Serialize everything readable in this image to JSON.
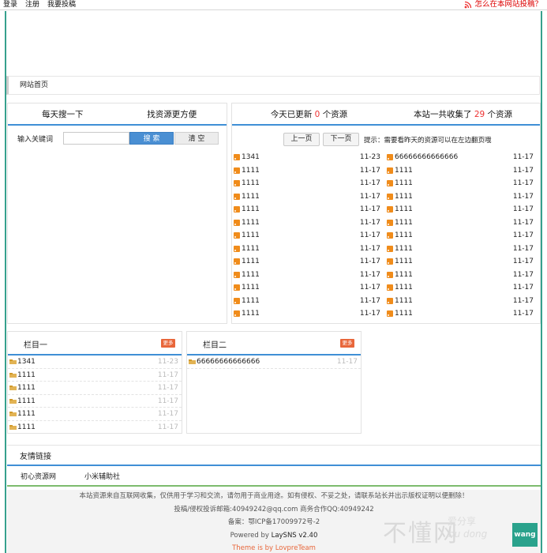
{
  "topbar": {
    "login": "登录",
    "register": "注册",
    "contribute": "我要投稿",
    "how_to_contribute": "怎么在本网站投稿？"
  },
  "nav": {
    "home": "网站首页"
  },
  "search": {
    "head_left": "每天搜一下",
    "head_right": "找资源更方便",
    "label": "输入关键词",
    "input_value": "",
    "search_btn": "搜 索",
    "clear_btn": "清 空"
  },
  "updates": {
    "today_prefix": "今天已更新",
    "today_count": "0",
    "today_suffix": "个资源",
    "total_prefix": "本站一共收集了",
    "total_count": "29",
    "total_suffix": "个资源",
    "prev": "上一页",
    "next": "下一页",
    "hint": "提示：需要看昨天的资源可以在左边翻页哦",
    "col1": [
      {
        "name": "1341",
        "date": "11-23"
      },
      {
        "name": "1111",
        "date": "11-17"
      },
      {
        "name": "1111",
        "date": "11-17"
      },
      {
        "name": "1111",
        "date": "11-17"
      },
      {
        "name": "1111",
        "date": "11-17"
      },
      {
        "name": "1111",
        "date": "11-17"
      },
      {
        "name": "1111",
        "date": "11-17"
      },
      {
        "name": "1111",
        "date": "11-17"
      },
      {
        "name": "1111",
        "date": "11-17"
      },
      {
        "name": "1111",
        "date": "11-17"
      },
      {
        "name": "1111",
        "date": "11-17"
      },
      {
        "name": "1111",
        "date": "11-17"
      },
      {
        "name": "1111",
        "date": "11-17"
      }
    ],
    "col2": [
      {
        "name": "66666666666666",
        "date": "11-17"
      },
      {
        "name": "1111",
        "date": "11-17"
      },
      {
        "name": "1111",
        "date": "11-17"
      },
      {
        "name": "1111",
        "date": "11-17"
      },
      {
        "name": "1111",
        "date": "11-17"
      },
      {
        "name": "1111",
        "date": "11-17"
      },
      {
        "name": "1111",
        "date": "11-17"
      },
      {
        "name": "1111",
        "date": "11-17"
      },
      {
        "name": "1111",
        "date": "11-17"
      },
      {
        "name": "1111",
        "date": "11-17"
      },
      {
        "name": "1111",
        "date": "11-17"
      },
      {
        "name": "1111",
        "date": "11-17"
      },
      {
        "name": "1111",
        "date": "11-17"
      }
    ]
  },
  "column1": {
    "title": "栏目一",
    "more": "更多",
    "items": [
      {
        "name": "1341",
        "date": "11-23"
      },
      {
        "name": "1111",
        "date": "11-17"
      },
      {
        "name": "1111",
        "date": "11-17"
      },
      {
        "name": "1111",
        "date": "11-17"
      },
      {
        "name": "1111",
        "date": "11-17"
      },
      {
        "name": "1111",
        "date": "11-17"
      }
    ]
  },
  "column2": {
    "title": "栏目二",
    "more": "更多",
    "items": [
      {
        "name": "66666666666666",
        "date": "11-17"
      }
    ]
  },
  "links": {
    "title": "友情链接",
    "items": [
      "初心资源网",
      "小米辅助社"
    ]
  },
  "footer": {
    "notice": "本站资源来自互联网收集，仅供用于学习和交流，请勿用于商业用途。如有侵权、不妥之处，请联系站长并出示版权证明以便删除！",
    "contact": "投稿/侵权投诉邮箱:40949242@qq.com 商务合作QQ:40949242",
    "icp_label": "备案：",
    "icp": "鄂ICP备17009972号-2",
    "powered_prefix": "Powered by",
    "powered": "LaySNS v2.40",
    "theme": "Theme is by LovpreTeam"
  },
  "watermark": {
    "big": "不懂网",
    "small1": "爱分享",
    "small2": "bu dong",
    "badge": "wang"
  },
  "colors": {
    "accent_blue": "#3f8fd6",
    "frame_green": "#36a08d",
    "highlight_red": "#e33",
    "more_orange": "#e8663a",
    "rss_orange": "#f08c1b"
  }
}
